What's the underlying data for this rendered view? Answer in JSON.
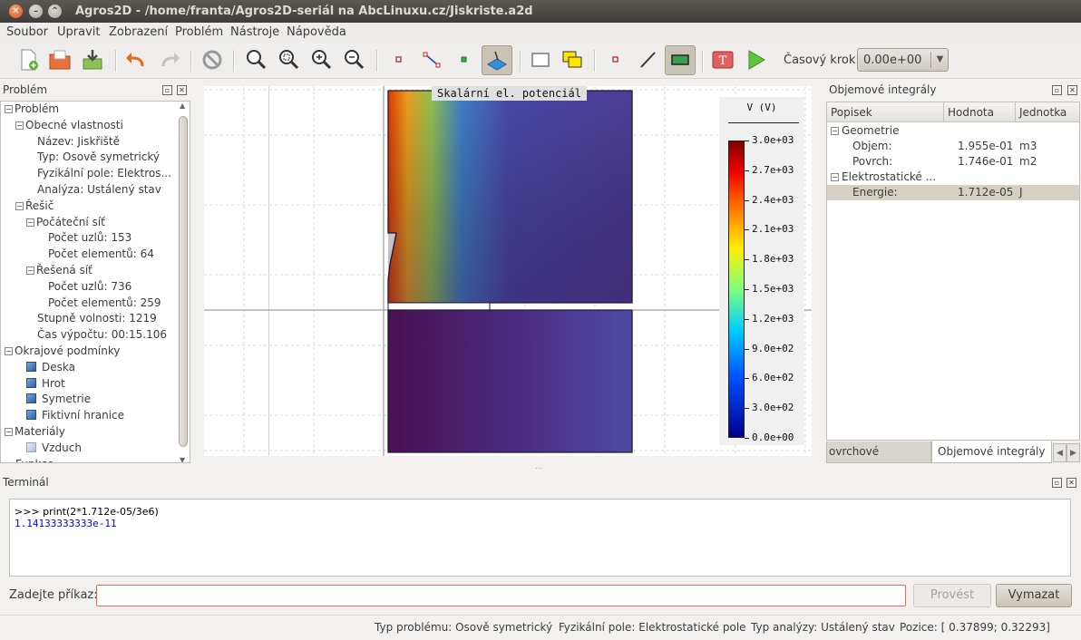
{
  "window": {
    "title": "Agros2D - /home/franta/Agros2D-seriál na AbcLinuxu.cz/Jiskriste.a2d"
  },
  "menu": [
    "Soubor",
    "Upravit",
    "Zobrazení",
    "Problém",
    "Nástroje",
    "Nápověda"
  ],
  "toolbar": {
    "timestep_label": "Časový krok:",
    "timestep_value": "0.00e+00"
  },
  "problem_panel": {
    "title": "Problém",
    "tree": [
      {
        "label": "Problém",
        "expander": "−"
      },
      {
        "label": "Obecné vlastnosti",
        "expander": "−"
      },
      {
        "label": "Název: Jiskřiště"
      },
      {
        "label": "Typ: Osově symetrický"
      },
      {
        "label": "Fyzikální pole: Elektros..."
      },
      {
        "label": "Analýza: Ustálený stav"
      },
      {
        "label": "Řešič",
        "expander": "−"
      },
      {
        "label": "Počáteční síť",
        "expander": "−"
      },
      {
        "label": "Počet uzlů: 153"
      },
      {
        "label": "Počet elementů: 64"
      },
      {
        "label": "Řešená síť",
        "expander": "−"
      },
      {
        "label": "Počet uzlů: 736"
      },
      {
        "label": "Počet elementů: 259"
      },
      {
        "label": "Stupně volnosti: 1219"
      },
      {
        "label": "Čas výpočtu: 00:15.106"
      },
      {
        "label": "Okrajové podmínky",
        "expander": "−"
      },
      {
        "label": "Deska",
        "icon": "boundary-icon"
      },
      {
        "label": "Hrot",
        "icon": "boundary-icon"
      },
      {
        "label": "Symetrie",
        "icon": "boundary-icon"
      },
      {
        "label": "Fiktivní hranice",
        "icon": "boundary-icon"
      },
      {
        "label": "Materiály",
        "expander": "−"
      },
      {
        "label": "Vzduch",
        "icon": "material-icon"
      },
      {
        "label": "Funkce"
      }
    ]
  },
  "view": {
    "title": "Skalární el. potenciál",
    "legend_title": "V (V)",
    "legend_labels": [
      "3.0e+03",
      "2.7e+03",
      "2.4e+03",
      "2.1e+03",
      "1.8e+03",
      "1.5e+03",
      "1.2e+03",
      "9.0e+02",
      "6.0e+02",
      "3.0e+02",
      "0.0e+00"
    ]
  },
  "integrals_panel": {
    "title": "Objemové integrály",
    "columns": [
      "Popisek",
      "Hodnota",
      "Jednotka"
    ],
    "rows": [
      {
        "label": "Geometrie",
        "group": true
      },
      {
        "label": "Objem:",
        "value": "1.955e-01",
        "unit": "m3"
      },
      {
        "label": "Povrch:",
        "value": "1.746e-01",
        "unit": "m2"
      },
      {
        "label": "Elektrostatické ...",
        "group": true
      },
      {
        "label": "Energie:",
        "value": "1.712e-05",
        "unit": "J",
        "selected": true
      }
    ],
    "tabs": [
      "ovrchové integrály",
      "Objemové integrály"
    ]
  },
  "terminal": {
    "title": "Terminál",
    "output": [
      ">>> print(2*1.712e-05/3e6)",
      "1.14133333333e-11"
    ],
    "command_label": "Zadejte příkaz:",
    "command_value": "",
    "run_button": "Provést",
    "clear_button": "Vymazat"
  },
  "status": {
    "problem_type": "Typ problému: Osově symetrický",
    "field": "Fyzikální pole: Elektrostatické pole",
    "analysis": "Typ analýzy: Ustálený stav",
    "position": "Pozice: [ 0.37899;  0.32293]"
  }
}
